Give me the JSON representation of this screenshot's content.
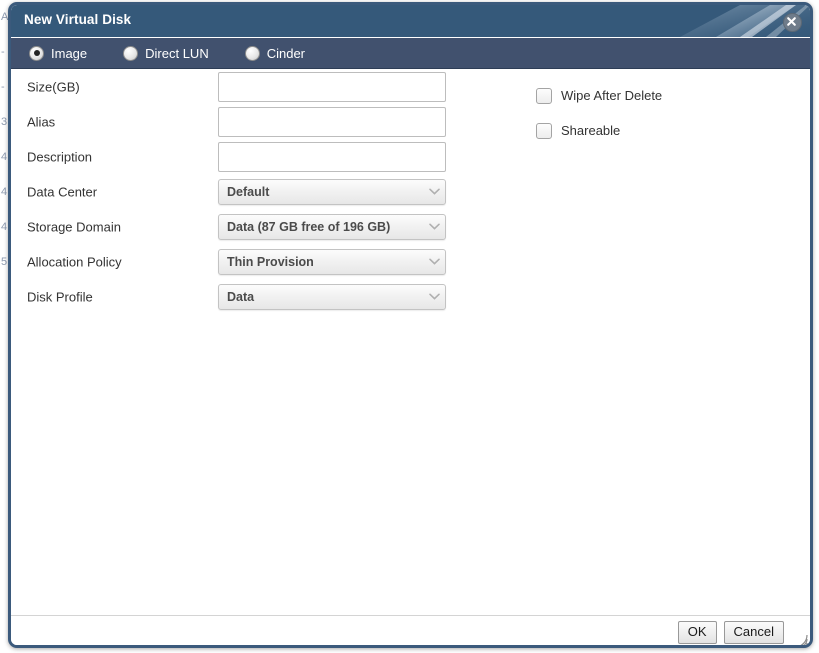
{
  "window": {
    "title": "New Virtual Disk",
    "close_icon": "close-circle-icon"
  },
  "disk_type": {
    "options": [
      {
        "label": "Image",
        "selected": true
      },
      {
        "label": "Direct LUN",
        "selected": false
      },
      {
        "label": "Cinder",
        "selected": false
      }
    ]
  },
  "form": {
    "fields": [
      {
        "label": "Size(GB)",
        "type": "text",
        "value": "",
        "placeholder": ""
      },
      {
        "label": "Alias",
        "type": "text",
        "value": "",
        "placeholder": ""
      },
      {
        "label": "Description",
        "type": "text",
        "value": "",
        "placeholder": ""
      },
      {
        "label": "Data Center",
        "type": "select",
        "value": "Default"
      },
      {
        "label": "Storage Domain",
        "type": "select",
        "value": "Data (87 GB free of 196 GB)"
      },
      {
        "label": "Allocation Policy",
        "type": "select",
        "value": "Thin Provision"
      },
      {
        "label": "Disk Profile",
        "type": "select",
        "value": "Data"
      }
    ]
  },
  "options": {
    "checkboxes": [
      {
        "label": "Wipe After Delete",
        "checked": false
      },
      {
        "label": "Shareable",
        "checked": false
      }
    ]
  },
  "footer": {
    "ok_label": "OK",
    "cancel_label": "Cancel"
  },
  "background_fragments": [
    "A",
    "-",
    "-",
    "3",
    "4",
    "4",
    "4",
    "5"
  ],
  "colors": {
    "titlebar": "#35597a",
    "radiobar": "#41516e",
    "border": "#3b5a7c"
  }
}
